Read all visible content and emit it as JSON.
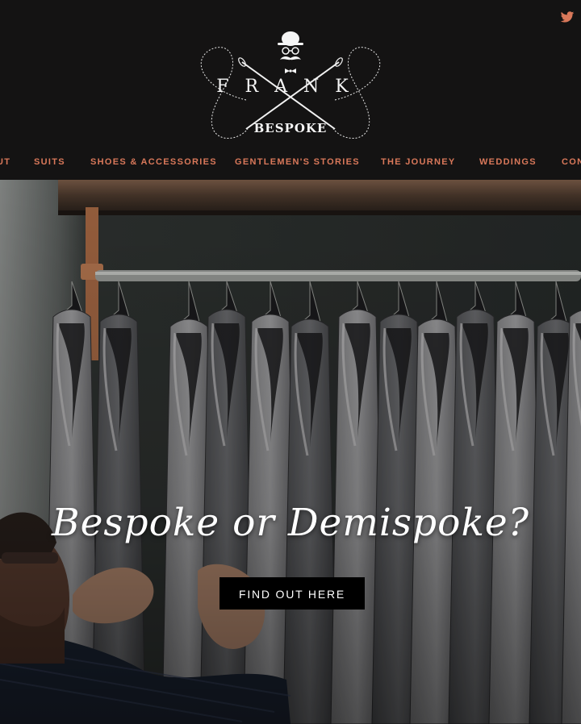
{
  "brand": {
    "top_word": "FRANK",
    "bottom_word": "BESPOKE"
  },
  "social": {
    "icon": "twitter-icon"
  },
  "nav": {
    "items": [
      {
        "label": "UT"
      },
      {
        "label": "SUITS"
      },
      {
        "label": "SHOES & ACCESSORIES"
      },
      {
        "label": "GENTLEMEN'S STORIES"
      },
      {
        "label": "THE JOURNEY"
      },
      {
        "label": "WEDDINGS"
      },
      {
        "label": "CON"
      }
    ]
  },
  "hero": {
    "headline": "Bespoke or Demispoke?",
    "cta_label": "FIND OUT HERE"
  },
  "colors": {
    "header_bg": "#141313",
    "accent": "#d9785a",
    "cta_bg": "#000000",
    "text_light": "#ffffff"
  }
}
